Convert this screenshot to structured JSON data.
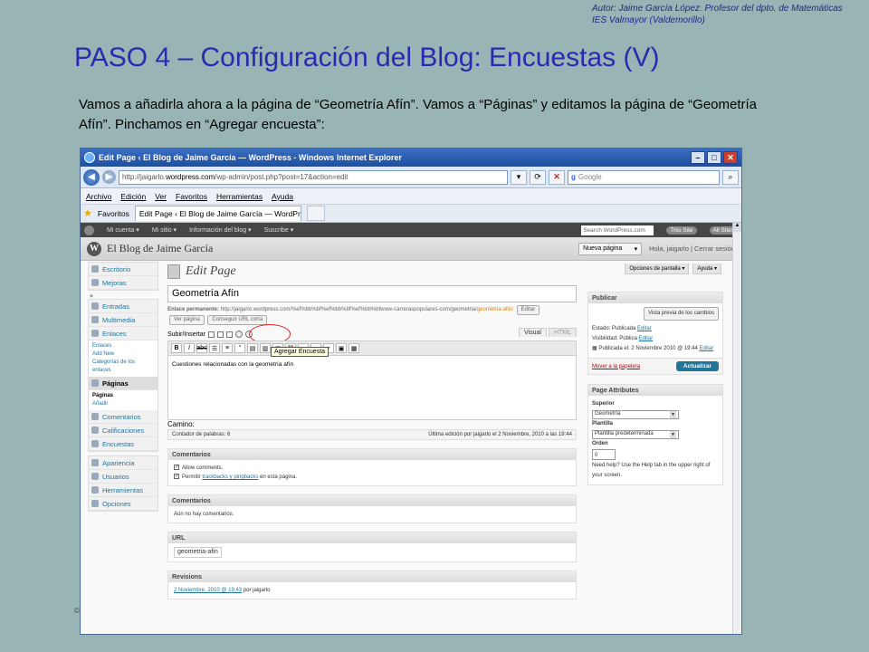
{
  "slide": {
    "author_line1": "Autor: Jaime García López. Profesor del dpto. de Matemáticas",
    "author_line2": "IES Valmayor (Valdemorillo)",
    "title": "PASO 4 – Configuración del Blog: Encuestas (V)",
    "intro": "Vamos a añadirla ahora a la página de “Geometría Afín”. Vamos a “Páginas” y editamos la página de “Geometría Afín”. Pinchamos en “Agregar encuesta”:",
    "copyright": "©"
  },
  "browser": {
    "window_title": "Edit Page ‹ El Blog de Jaime García — WordPress - Windows Internet Explorer",
    "address_prefix": "http://jaigarlo.",
    "address_domain": "wordpress.com",
    "address_suffix": "/wp-admin/post.php?post=17&action=edit",
    "search_placeholder": "Google",
    "menu": [
      "Archivo",
      "Edición",
      "Ver",
      "Favoritos",
      "Herramientas",
      "Ayuda"
    ],
    "favorites_label": "Favoritos",
    "tab_label": "Edit Page ‹ El Blog de Jaime García — WordPress"
  },
  "adminbar": {
    "items": [
      "Mi cuenta ▾",
      "Mi sitio ▾",
      "Información del blog ▾",
      "Suscribe ▾"
    ],
    "search_placeholder": "Search WordPress.com",
    "this_site": "This Site",
    "all_sites": "All Sites"
  },
  "wp_header": {
    "blog_name": "El Blog de Jaime García",
    "new_page": "Nueva página",
    "howdy": "Hola, jaigarlo | Cerrar sesión",
    "screen_options": "Opciones de pantalla ▾",
    "help": "Ayuda ▾"
  },
  "sidebar": {
    "escritorio": "Escritorio",
    "mejoras": "Mejoras",
    "entradas": "Entradas",
    "multimedia": "Multimedia",
    "enlaces": "Enlaces",
    "enlaces_sub": [
      "Enlaces",
      "Add New",
      "Categorías de los enlaces"
    ],
    "paginas": "Páginas",
    "paginas_sub_current": "Páginas",
    "paginas_sub_add": "Añadir",
    "comentarios": "Comentarios",
    "calificaciones": "Calificaciones",
    "encuestas": "Encuestas",
    "apariencia": "Apariencia",
    "usuarios": "Usuarios",
    "herramientas": "Herramientas",
    "opciones": "Opciones"
  },
  "editor": {
    "heading": "Edit Page",
    "post_title": "Geometría Afín",
    "permalink_label": "Enlace permanente:",
    "permalink_url": "http://jaigarlo.wordpress.com/%ef%bb%bf%ef%bb%bf%ef%bb%bfwww-carreraspopulares-com/geometria/",
    "permalink_slug": "geometria-afin/",
    "edit_btn": "Editar",
    "view_btn": "Ver página",
    "short_url_btn": "Conseguir URL corta",
    "upload_label": "Subir/Insertar",
    "tab_visual": "Visual",
    "tab_html": "HTML",
    "tooltip": "Agregar Encuesta",
    "content": "Cuestiones relacionadas con la geometría afín",
    "path_label": "Camino:",
    "word_count": "Contador de palabras: 6",
    "last_edit": "Última edición por jaigarlo el 2 Noviembre, 2010 a las 19:44"
  },
  "boxes": {
    "comments_h": "Comentarios",
    "allow_comments": "Allow comments.",
    "allow_trackbacks_pre": "Permitir",
    "trackbacks_link": "trackbacks y pingbacks",
    "allow_trackbacks_post": "en esta página.",
    "comments2_h": "Comentarios",
    "no_comments": "Aún no hay comentarios.",
    "url_h": "URL",
    "url_slug": "geometria-afin",
    "revisions_h": "Revisions",
    "revision_link": "2 Noviembre, 2010 @ 19:43",
    "revision_by": "por jaigarlo"
  },
  "publish": {
    "heading": "Publicar",
    "preview_btn": "Vista previa de los cambios",
    "status": "Estado: Publicada",
    "visibility": "Visibilidad: Pública",
    "published_on": "Publicada el: 2 Noviembre 2010 @ 19:44",
    "edit": "Editar",
    "trash": "Mover a la papelera",
    "update": "Actualizar"
  },
  "attributes": {
    "heading": "Page Attributes",
    "parent_label": "Superior",
    "parent_value": "Geometría",
    "template_label": "Plantilla",
    "template_value": "Plantilla predeterminada",
    "order_label": "Orden",
    "order_value": "0",
    "help": "Need help? Use the Help tab in the upper right of your screen."
  }
}
